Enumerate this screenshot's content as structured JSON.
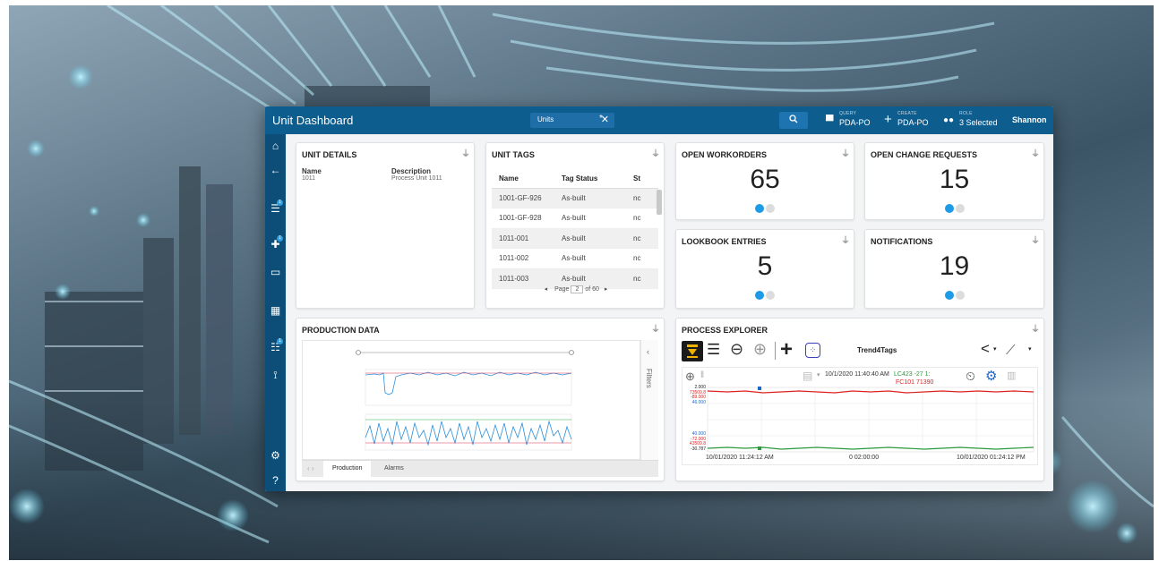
{
  "header": {
    "title": "Unit Dashboard",
    "tab_label": "Units",
    "tab_close": "✕",
    "tab_add": "*",
    "query_small": "QUERY",
    "query_label": "PDA-PO",
    "create_small": "CREATE",
    "create_label": "PDA-PO",
    "role_small": "ROLE",
    "role_label": "3 Selected",
    "user": "Shannon"
  },
  "sidebar": {
    "badges": [
      "1",
      "1",
      "1"
    ]
  },
  "unit_details": {
    "title": "UNIT DETAILS",
    "name_label": "Name",
    "name_value": "1011",
    "desc_label": "Description",
    "desc_value": "Process Unit 1011"
  },
  "unit_tags": {
    "title": "UNIT TAGS",
    "columns": [
      "Name",
      "Tag Status",
      "St"
    ],
    "rows": [
      [
        "1001-GF-926",
        "As-built",
        "nc"
      ],
      [
        "1001-GF-928",
        "As-built",
        "nc"
      ],
      [
        "1011-001",
        "As-built",
        "nc"
      ],
      [
        "1011-002",
        "As-built",
        "nc"
      ],
      [
        "1011-003",
        "As-built",
        "nc"
      ]
    ],
    "page_label": "Page",
    "page_value": "2",
    "page_total": "of 60"
  },
  "kpis": {
    "open_workorders": {
      "title": "OPEN WORKORDERS",
      "value": "65"
    },
    "open_change_requests": {
      "title": "OPEN CHANGE REQUESTS",
      "value": "15"
    },
    "lookbook_entries": {
      "title": "LOOKBOOK ENTRIES",
      "value": "5"
    },
    "notifications": {
      "title": "NOTIFICATIONS",
      "value": "19"
    }
  },
  "production": {
    "title": "PRODUCTION DATA",
    "tabs": [
      "Production",
      "Alarms"
    ],
    "filters_label": "Filters"
  },
  "process_explorer": {
    "title": "PROCESS EXPLORER",
    "trend_name": "Trend4Tags",
    "timestamp": "10/1/2020 11:40:40 AM",
    "tag1": "LC423 -27 1:",
    "tag2": "FC101 71390",
    "axis_top": [
      "2.000",
      "73509.8",
      "-89.000",
      "46.000"
    ],
    "axis_bottom": [
      "40.000",
      "-72.000",
      "43509.8",
      "-30.787"
    ],
    "start_time": "10/01/2020 11:24:12 AM",
    "duration": "0 02:00:00",
    "end_time": "10/01/2020 01:24:12 PM"
  },
  "colors": {
    "header": "#0d5d8f",
    "sidebar": "#0c4e78",
    "accent": "#1e9be6",
    "dot_inactive": "#dcdcdc"
  }
}
